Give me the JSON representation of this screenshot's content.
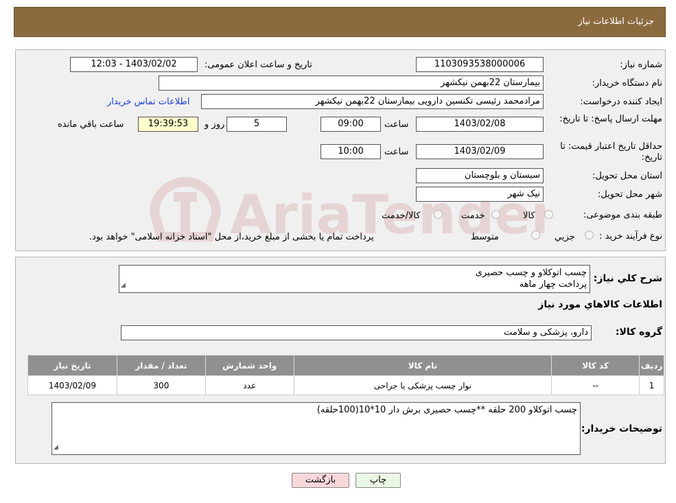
{
  "header": {
    "title": "جزئیات اطلاعات نیاز"
  },
  "form": {
    "need_number_label": "شماره نیاز:",
    "need_number": "1103093538000006",
    "announce_label": "تاریخ و ساعت اعلان عمومی:",
    "announce_value": "1403/02/02 - 12:03",
    "buyer_org_label": "نام دستگاه خریدار:",
    "buyer_org": "بیمارستان 22بهمن نیکشهر",
    "requester_label": "ایجاد کننده درخواست:",
    "requester": "مرادمحمد رئیسی تکنسین دارویی بیمارستان 22بهمن نیکشهر",
    "contact_link": "اطلاعات تماس خریدار",
    "deadline_label": "مهلت ارسال پاسخ: تا تاریخ:",
    "deadline_date": "1403/02/08",
    "time_label": "ساعت",
    "deadline_time": "09:00",
    "days_value": "5",
    "days_label": "روز و",
    "remaining_time": "19:39:53",
    "remaining_label": "ساعت باقي مانده",
    "validity_label": "حداقل تاریخ اعتبار قیمت: تا تاریخ:",
    "validity_date": "1403/02/09",
    "validity_time": "10:00",
    "province_label": "استان محل تحویل:",
    "province": "سیستان و بلوچستان",
    "city_label": "شهر محل تحویل:",
    "city": "نیک شهر",
    "category_label": "طبقه بندی موضوعی:",
    "category_options": [
      "کالا",
      "خدمت",
      "کالا/خدمت"
    ],
    "process_label": "نوع فرآیند خرید :",
    "process_options": [
      "جزيي",
      "متوسط"
    ],
    "process_note": "پرداخت تمام یا بخشی از مبلغ خرید،از محل \"اسناد خزانه اسلامی\" خواهد بود."
  },
  "summary": {
    "description_label": "شرح کلي نياز:",
    "description_line1": "چسب اتوکلاو و چسب حصیری",
    "description_line2": "پرداخت چهار ماهه",
    "goods_info_title": "اطلاعات کالاهاي مورد نياز",
    "goods_group_label": "گروه کالا:",
    "goods_group": "دارو، پزشکی و سلامت"
  },
  "table": {
    "headers": [
      "رديف",
      "کد کالا",
      "نام کالا",
      "واحد شمارش",
      "تعداد / مقدار",
      "تاریخ نیاز"
    ],
    "rows": [
      [
        "1",
        "--",
        "نوار چسب پزشکی یا جراحی",
        "عدد",
        "300",
        "1403/02/09"
      ]
    ]
  },
  "notes": {
    "label": "توضیحات خریدار:",
    "text": "چسب اتوکلاو 200 حلقه **چسب حصیری برش دار 10*10(100حلقه)"
  },
  "buttons": {
    "print": "چاپ",
    "back": "بازگشت"
  },
  "watermark": {
    "text": "AriaTender.neT"
  },
  "colors": {
    "header_bg": "#8b6a3e",
    "panel_bg": "#f0f0f0",
    "table_header_bg": "#909090",
    "link": "#1a3fd1",
    "time_highlight": "#ffffcc",
    "back_button_bg": "#f8d7da"
  }
}
